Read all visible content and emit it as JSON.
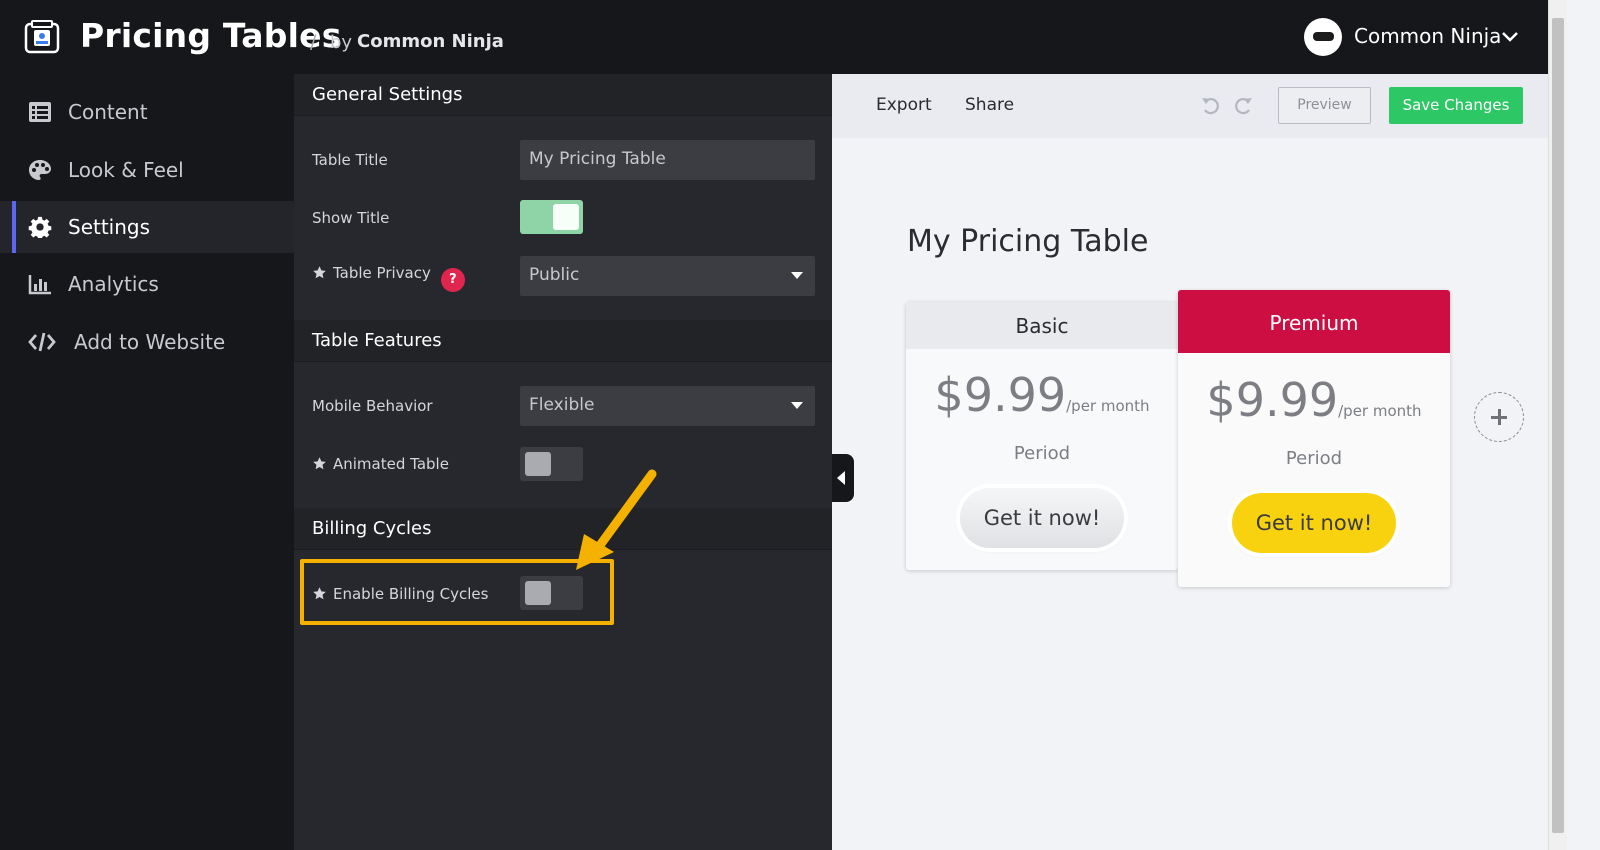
{
  "app": {
    "title": "Pricing Tables",
    "separator": "/",
    "by": "by",
    "brand": "Common Ninja"
  },
  "user": {
    "name": "Common Ninja"
  },
  "nav": {
    "items": [
      {
        "label": "Content",
        "icon": "list-icon"
      },
      {
        "label": "Look & Feel",
        "icon": "palette-icon"
      },
      {
        "label": "Settings",
        "icon": "gear-icon",
        "active": true
      },
      {
        "label": "Analytics",
        "icon": "bar-chart-icon"
      },
      {
        "label": "Add to Website",
        "icon": "code-icon"
      }
    ]
  },
  "settings": {
    "general": {
      "header": "General Settings",
      "table_title_label": "Table Title",
      "table_title_value": "My Pricing Table",
      "show_title_label": "Show Title",
      "show_title_on": true,
      "privacy_label": "Table Privacy",
      "privacy_help": "?",
      "privacy_value": "Public"
    },
    "features": {
      "header": "Table Features",
      "mobile_label": "Mobile Behavior",
      "mobile_value": "Flexible",
      "animated_label": "Animated Table",
      "animated_on": false
    },
    "billing": {
      "header": "Billing Cycles",
      "enable_label": "Enable Billing Cycles",
      "enable_on": false
    }
  },
  "toolbar": {
    "export": "Export",
    "share": "Share",
    "preview": "Preview",
    "save": "Save Changes"
  },
  "preview": {
    "title": "My Pricing Table",
    "plans": [
      {
        "name": "Basic",
        "price": "$9.99",
        "per": "/per month",
        "period": "Period",
        "cta": "Get it now!"
      },
      {
        "name": "Premium",
        "price": "$9.99",
        "per": "/per month",
        "period": "Period",
        "cta": "Get it now!"
      }
    ]
  },
  "colors": {
    "accent_nav": "#5a68f0",
    "save_green": "#2ec766",
    "premium_red": "#cc0e42",
    "cta_yellow": "#f9d20f",
    "highlight_orange": "#f5b100",
    "help_red": "#e0254f"
  }
}
